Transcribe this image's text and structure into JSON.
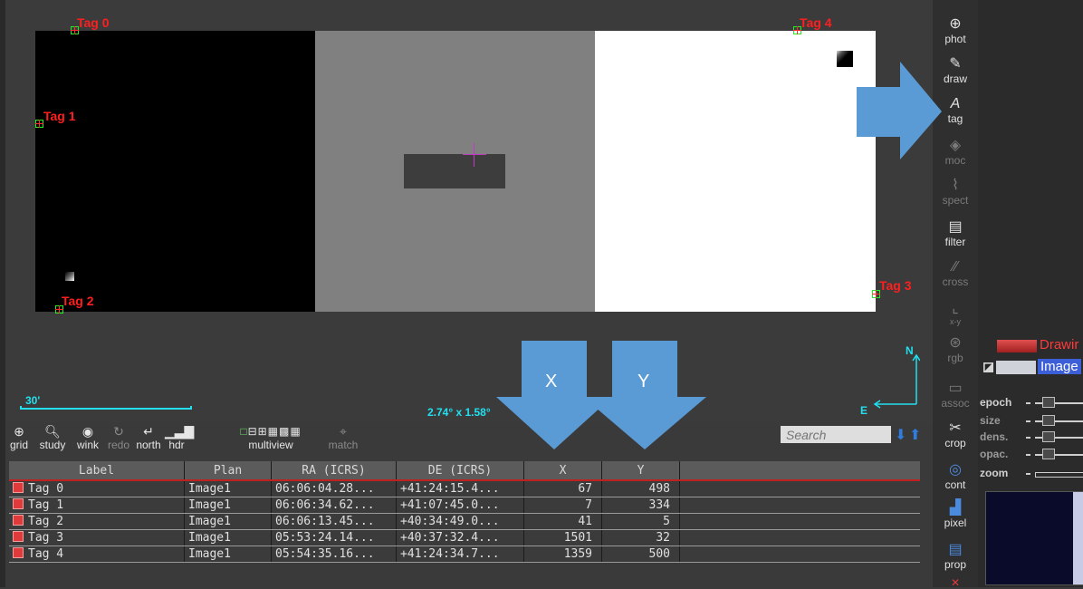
{
  "viewer": {
    "tags": [
      {
        "label": "Tag 0"
      },
      {
        "label": "Tag 1"
      },
      {
        "label": "Tag 2"
      },
      {
        "label": "Tag 3"
      },
      {
        "label": "Tag 4"
      }
    ],
    "scale_label": "30'",
    "fov_label": "2.74° x 1.58°",
    "compass_north": "N",
    "compass_east": "E"
  },
  "overlay_arrows": {
    "x_label": "X",
    "y_label": "Y"
  },
  "toolbar": {
    "items": [
      {
        "label": "grid",
        "icon": "globe-icon"
      },
      {
        "label": "study",
        "icon": "magnifier-icon"
      },
      {
        "label": "wink",
        "icon": "eye-icon"
      },
      {
        "label": "redo",
        "icon": "redo-icon"
      },
      {
        "label": "north",
        "icon": "north-arrow-icon"
      },
      {
        "label": "hdr",
        "icon": "histogram-icon"
      },
      {
        "label": "multiview",
        "icon": "multiview-icon"
      },
      {
        "label": "match",
        "icon": "target-icon"
      }
    ],
    "search_placeholder": "Search"
  },
  "table": {
    "columns": [
      "Label",
      "Plan",
      "RA (ICRS)",
      "DE (ICRS)",
      "X",
      "Y"
    ],
    "rows": [
      {
        "label": "Tag 0",
        "plan": "Image1",
        "ra": "06:06:04.28...",
        "de": "+41:24:15.4...",
        "x": "67",
        "y": "498"
      },
      {
        "label": "Tag 1",
        "plan": "Image1",
        "ra": "06:06:34.62...",
        "de": "+41:07:45.0...",
        "x": "7",
        "y": "334"
      },
      {
        "label": "Tag 2",
        "plan": "Image1",
        "ra": "06:06:13.45...",
        "de": "+40:34:49.0...",
        "x": "41",
        "y": "5"
      },
      {
        "label": "Tag 3",
        "plan": "Image1",
        "ra": "05:53:24.14...",
        "de": "+40:37:32.4...",
        "x": "1501",
        "y": "32"
      },
      {
        "label": "Tag 4",
        "plan": "Image1",
        "ra": "05:54:35.16...",
        "de": "+41:24:34.7...",
        "x": "1359",
        "y": "500"
      }
    ]
  },
  "tools": [
    {
      "label": "phot",
      "icon": "phot-icon"
    },
    {
      "label": "draw",
      "icon": "pencil-icon"
    },
    {
      "label": "tag",
      "icon": "tag-icon"
    },
    {
      "label": "moc",
      "icon": "moc-icon"
    },
    {
      "label": "spect",
      "icon": "spectrum-icon"
    },
    {
      "label": "filter",
      "icon": "filter-icon"
    },
    {
      "label": "cross",
      "icon": "cross-icon"
    },
    {
      "label": "x-y",
      "icon": "xy-plot-icon"
    },
    {
      "label": "rgb",
      "icon": "rgb-icon"
    },
    {
      "label": "assoc",
      "icon": "assoc-icon"
    },
    {
      "label": "crop",
      "icon": "scissors-icon"
    },
    {
      "label": "cont",
      "icon": "contour-icon"
    },
    {
      "label": "pixel",
      "icon": "pixel-icon"
    },
    {
      "label": "prop",
      "icon": "prop-icon"
    }
  ],
  "layers": {
    "drawing_label": "Drawir",
    "image_label": "Image"
  },
  "sliders": [
    {
      "label": "epoch"
    },
    {
      "label": "size"
    },
    {
      "label": "dens."
    },
    {
      "label": "opac."
    },
    {
      "label": "zoom"
    }
  ],
  "colors": {
    "tag_red": "#ff1f1f",
    "marker_green": "#22ee22",
    "overlay_blue": "#5b9bd5",
    "cyan": "#22e0f0",
    "accent_header_line": "#c02020"
  }
}
